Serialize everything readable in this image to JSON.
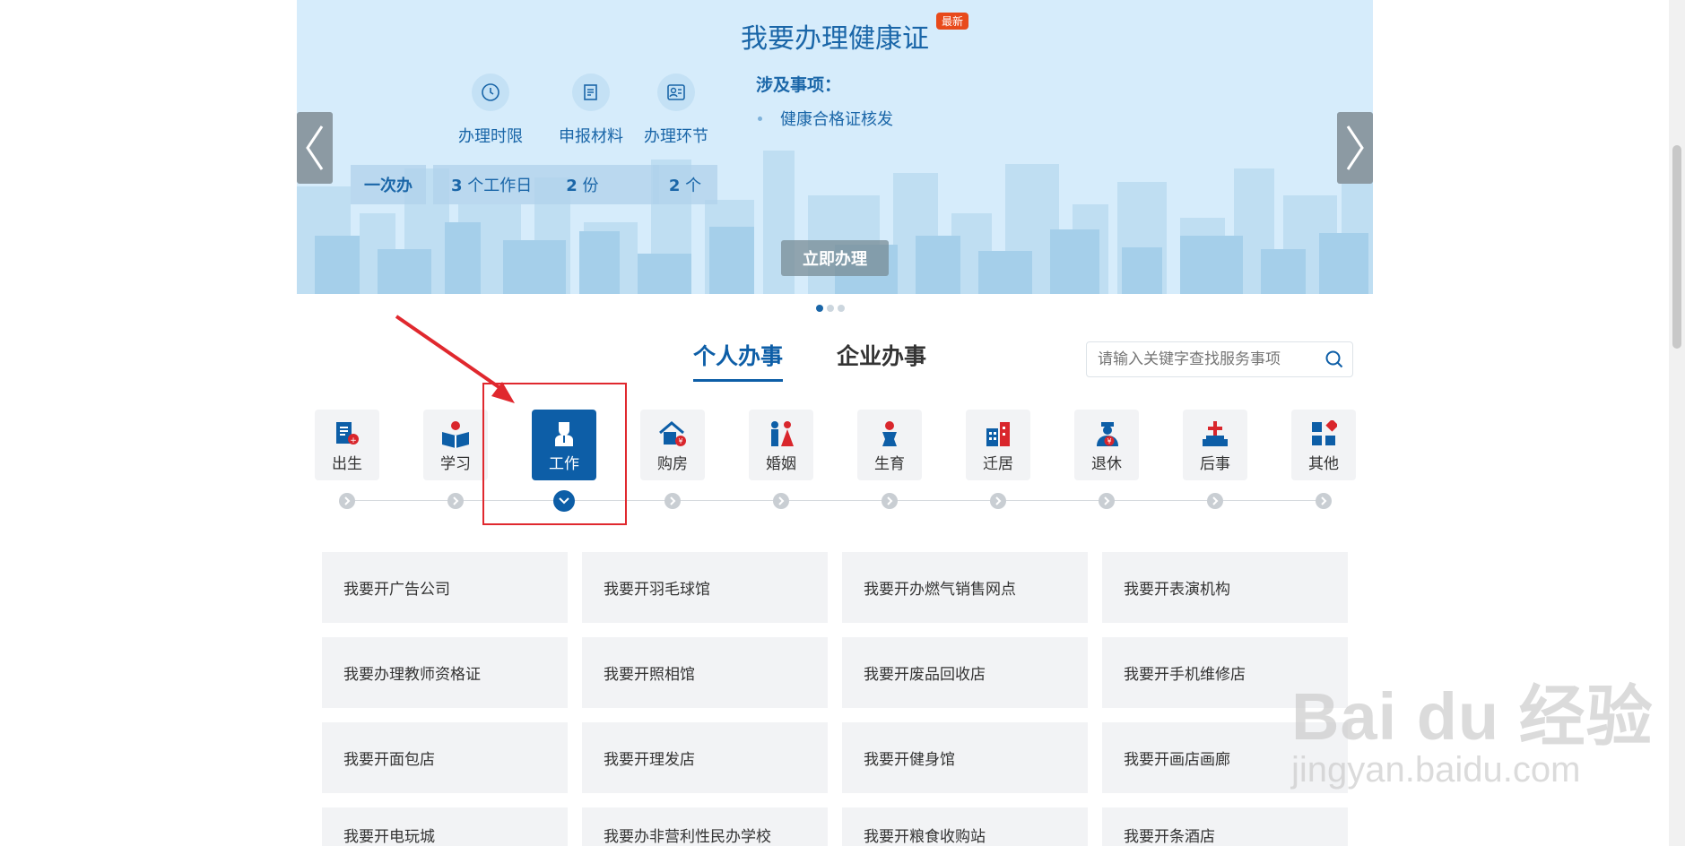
{
  "banner": {
    "title": "我要办理健康证",
    "badge": "最新",
    "features": [
      {
        "label": "办理时限",
        "icon": "clock-icon"
      },
      {
        "label": "申报材料",
        "icon": "document-icon"
      },
      {
        "label": "办理环节",
        "icon": "person-list-icon"
      }
    ],
    "stats": {
      "once_label": "一次办",
      "time_value": "3",
      "time_unit": "个工作日",
      "materials_value": "2",
      "materials_unit": "份",
      "steps_value": "2",
      "steps_unit": "个"
    },
    "involved_title": "涉及事项：",
    "involved_items": [
      "健康合格证核发"
    ],
    "apply_label": "立即办理",
    "slide_count": 3,
    "active_slide": 1
  },
  "tabs": [
    {
      "label": "个人办事",
      "active": true
    },
    {
      "label": "企业办事",
      "active": false
    }
  ],
  "search": {
    "placeholder": "请输入关键字查找服务事项"
  },
  "categories": [
    {
      "label": "出生",
      "icon": "birth-certificate-icon"
    },
    {
      "label": "学习",
      "icon": "student-reading-icon"
    },
    {
      "label": "工作",
      "icon": "worker-icon",
      "active": true
    },
    {
      "label": "购房",
      "icon": "house-icon"
    },
    {
      "label": "婚姻",
      "icon": "couple-icon"
    },
    {
      "label": "生育",
      "icon": "baby-icon"
    },
    {
      "label": "迁居",
      "icon": "building-icon"
    },
    {
      "label": "退休",
      "icon": "retiree-icon"
    },
    {
      "label": "后事",
      "icon": "memorial-icon"
    },
    {
      "label": "其他",
      "icon": "grid-icon"
    }
  ],
  "services": [
    [
      "我要开广告公司",
      "我要开羽毛球馆",
      "我要开办燃气销售网点",
      "我要开表演机构"
    ],
    [
      "我要办理教师资格证",
      "我要开照相馆",
      "我要开废品回收店",
      "我要开手机维修店"
    ],
    [
      "我要开面包店",
      "我要开理发店",
      "我要开健身馆",
      "我要开画店画廊"
    ],
    [
      "我要开电玩城",
      "我要办非营利性民办学校",
      "我要开粮食收购站",
      "我要开条酒店"
    ]
  ],
  "watermark": {
    "line1": "Bai du 经验",
    "line2": "jingyan.baidu.com"
  },
  "colors": {
    "primary": "#0d5ea7",
    "banner_bg": "#d6ecfb",
    "highlight": "#e0282e",
    "tile_bg": "#f2f3f5"
  }
}
